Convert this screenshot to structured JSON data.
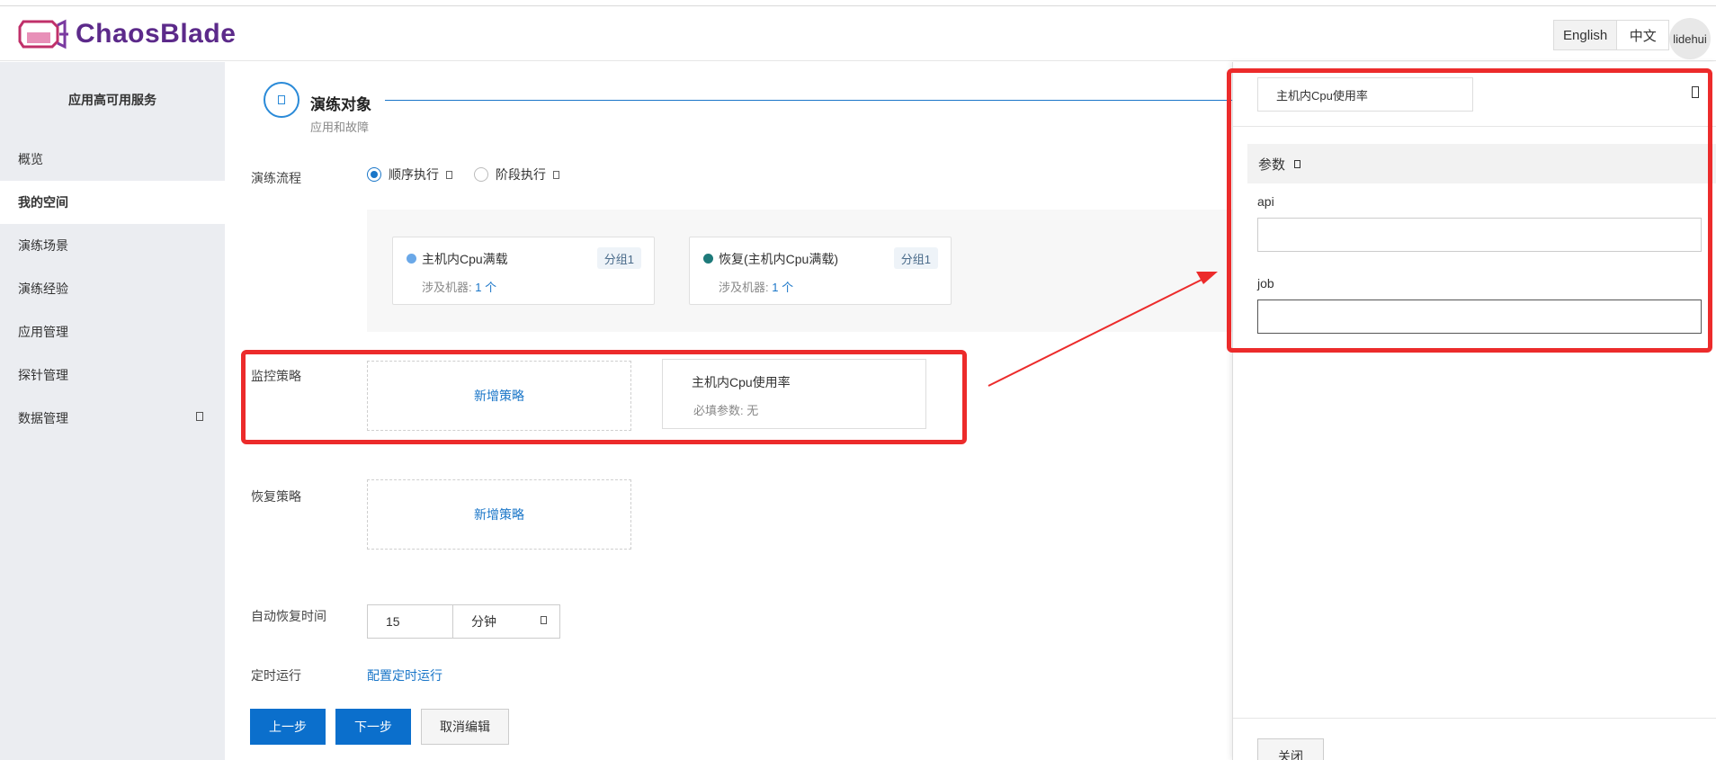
{
  "header": {
    "brand": "ChaosBlade",
    "lang_english": "English",
    "lang_chinese": "中文",
    "user": "lidehui"
  },
  "sidebar": {
    "title": "应用高可用服务",
    "items": [
      {
        "label": "概览"
      },
      {
        "label": "我的空间"
      },
      {
        "label": "演练场景"
      },
      {
        "label": "演练经验"
      },
      {
        "label": "应用管理"
      },
      {
        "label": "探针管理"
      },
      {
        "label": "数据管理"
      }
    ]
  },
  "step": {
    "title": "演练对象",
    "subtitle": "应用和故障"
  },
  "form": {
    "flow_label": "演练流程",
    "flow_options": [
      "顺序执行",
      "阶段执行"
    ],
    "flow_selected": "顺序执行",
    "flow_nodes": [
      {
        "name": "主机内Cpu满载",
        "group": "分组1",
        "machines_prefix": "涉及机器: ",
        "machines": "1 个",
        "dot_color": "#6aa8e8"
      },
      {
        "name": "恢复(主机内Cpu满载)",
        "group": "分组1",
        "machines_prefix": "涉及机器: ",
        "machines": "1 个",
        "dot_color": "#1e7a7a"
      }
    ],
    "monitor_label": "监控策略",
    "add_strategy": "新增策略",
    "monitor_card_title": "主机内Cpu使用率",
    "monitor_card_sub": "必填参数: 无",
    "recover_label": "恢复策略",
    "auto_recover_label": "自动恢复时间",
    "auto_recover_value": "15",
    "auto_recover_unit": "分钟",
    "timer_label": "定时运行",
    "timer_link": "配置定时运行",
    "btn_prev": "上一步",
    "btn_next": "下一步",
    "btn_cancel": "取消编辑"
  },
  "drawer": {
    "title_value": "主机内Cpu使用率",
    "params_title": "参数",
    "fields": [
      {
        "label": "api",
        "value": ""
      },
      {
        "label": "job",
        "value": ""
      }
    ],
    "close_label": "关闭"
  },
  "colors": {
    "primary": "#0b6fcc",
    "highlight": "#ec2b2b",
    "brand": "#5c2a8a"
  }
}
